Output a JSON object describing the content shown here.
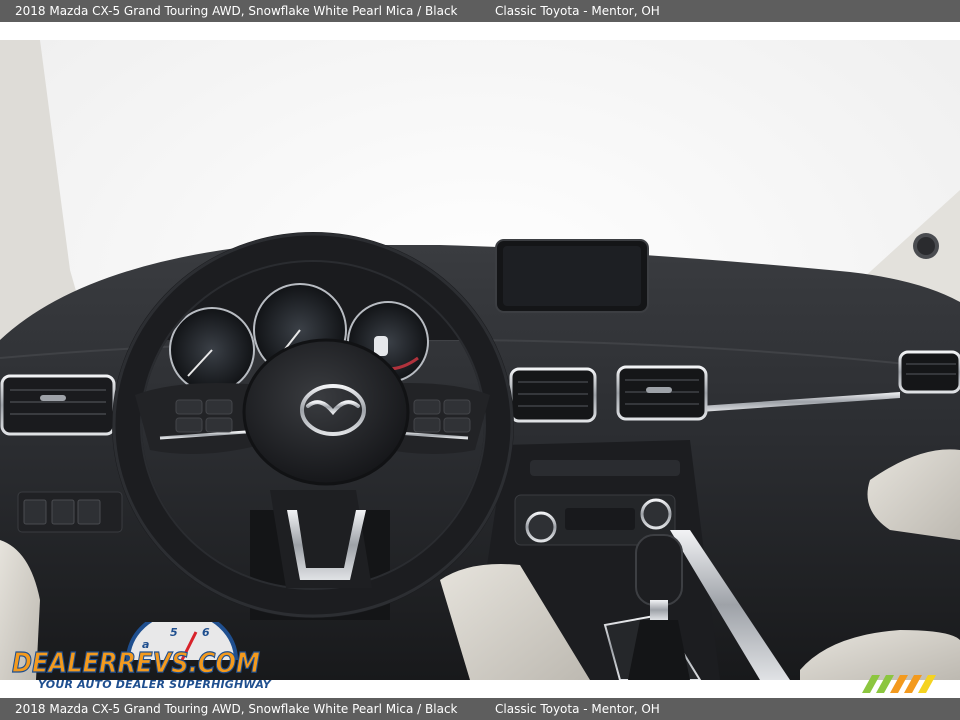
{
  "caption": {
    "vehicle": "2018 Mazda CX-5 Grand Touring AWD,  Snowflake White Pearl Mica / Black",
    "dealer": "Classic Toyota - Mentor, OH"
  },
  "watermark": {
    "brand": "DEALERREVS.COM",
    "tagline": "YOUR AUTO DEALER SUPERHIGHWAY"
  },
  "colors": {
    "caption_bg": "#5e5e5e",
    "dashboard": "#2b2d31",
    "windshield": "#f7f7f7",
    "leather": "#d9d6cf",
    "chrome": "#c9ccd1",
    "watermark_blue": "#1f4f8f",
    "watermark_orange": "#f39a1e",
    "watermark_green": "#8cc63f"
  }
}
